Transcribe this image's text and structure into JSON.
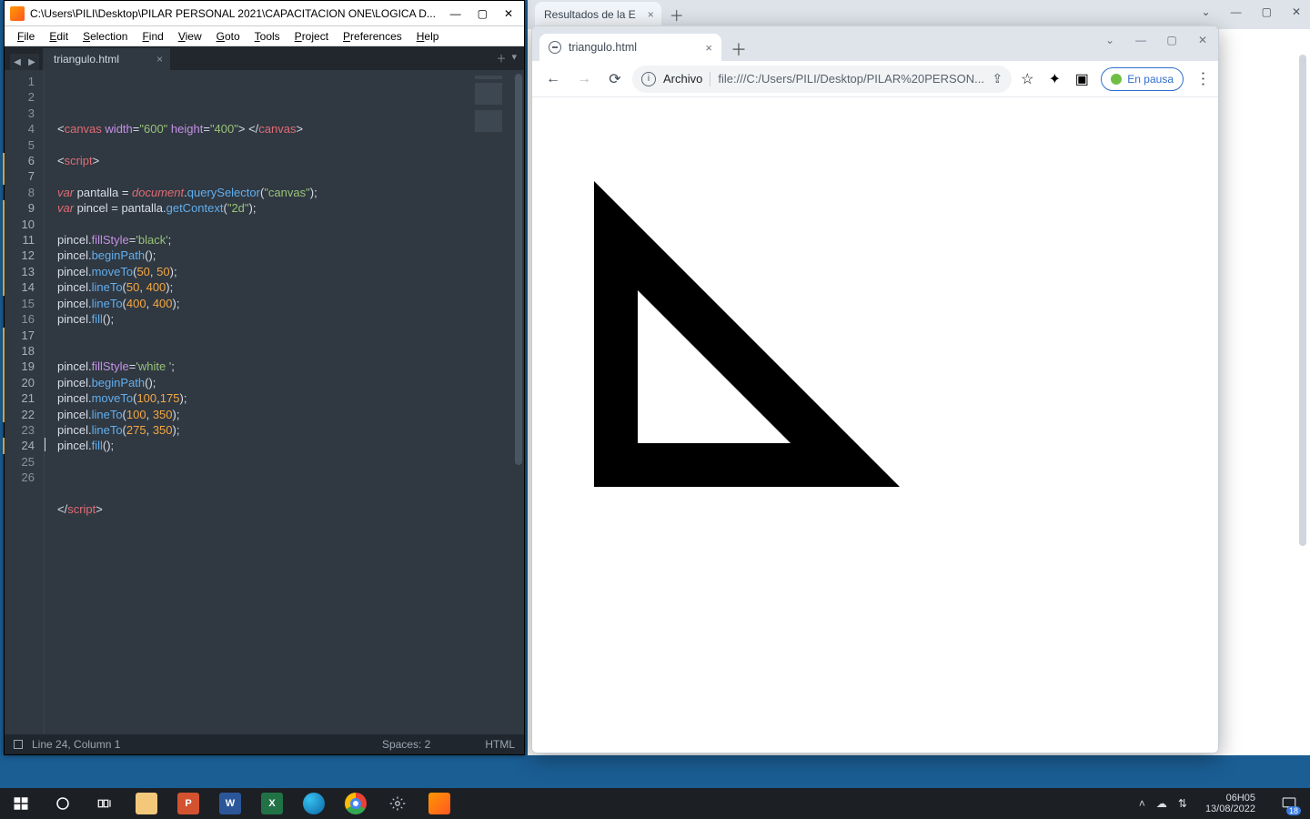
{
  "sublime": {
    "title": "C:\\Users\\PILI\\Desktop\\PILAR PERSONAL 2021\\CAPACITACION ONE\\LOGICA D...",
    "menu": [
      "File",
      "Edit",
      "Selection",
      "Find",
      "View",
      "Goto",
      "Tools",
      "Project",
      "Preferences",
      "Help"
    ],
    "tab": "triangulo.html",
    "status_left": "Line 24, Column 1",
    "status_spaces": "Spaces: 2",
    "status_lang": "HTML",
    "line_count": 26
  },
  "code_tokens": [
    [],
    [
      [
        "d",
        "<"
      ],
      [
        "t",
        "canvas"
      ],
      [
        "d",
        " "
      ],
      [
        "a",
        "width"
      ],
      [
        "d",
        "="
      ],
      [
        "s",
        "\"600\""
      ],
      [
        "d",
        " "
      ],
      [
        "a",
        "height"
      ],
      [
        "d",
        "="
      ],
      [
        "s",
        "\"400\""
      ],
      [
        "d",
        "> </"
      ],
      [
        "t",
        "canvas"
      ],
      [
        "d",
        ">"
      ]
    ],
    [],
    [
      [
        "d",
        "<"
      ],
      [
        "t",
        "script"
      ],
      [
        "d",
        ">"
      ]
    ],
    [],
    [
      [
        "k",
        "var"
      ],
      [
        "d",
        " pantalla = "
      ],
      [
        "k",
        "document"
      ],
      [
        "d",
        "."
      ],
      [
        "c",
        "querySelector"
      ],
      [
        "d",
        "("
      ],
      [
        "s",
        "\"canvas\""
      ],
      [
        "d",
        ");"
      ]
    ],
    [
      [
        "k",
        "var"
      ],
      [
        "d",
        " pincel = pantalla."
      ],
      [
        "c",
        "getContext"
      ],
      [
        "d",
        "("
      ],
      [
        "s",
        "\"2d\""
      ],
      [
        "d",
        ");"
      ]
    ],
    [],
    [
      [
        "d",
        "pincel."
      ],
      [
        "a",
        "fillStyle"
      ],
      [
        "d",
        "="
      ],
      [
        "s",
        "'black'"
      ],
      [
        "d",
        ";"
      ]
    ],
    [
      [
        "d",
        "pincel."
      ],
      [
        "c",
        "beginPath"
      ],
      [
        "d",
        "();"
      ]
    ],
    [
      [
        "d",
        "pincel."
      ],
      [
        "c",
        "moveTo"
      ],
      [
        "d",
        "("
      ],
      [
        "n",
        "50"
      ],
      [
        "d",
        ", "
      ],
      [
        "n",
        "50"
      ],
      [
        "d",
        ");"
      ]
    ],
    [
      [
        "d",
        "pincel."
      ],
      [
        "c",
        "lineTo"
      ],
      [
        "d",
        "("
      ],
      [
        "n",
        "50"
      ],
      [
        "d",
        ", "
      ],
      [
        "n",
        "400"
      ],
      [
        "d",
        ");"
      ]
    ],
    [
      [
        "d",
        "pincel."
      ],
      [
        "c",
        "lineTo"
      ],
      [
        "d",
        "("
      ],
      [
        "n",
        "400"
      ],
      [
        "d",
        ", "
      ],
      [
        "n",
        "400"
      ],
      [
        "d",
        ");"
      ]
    ],
    [
      [
        "d",
        "pincel."
      ],
      [
        "c",
        "fill"
      ],
      [
        "d",
        "();"
      ]
    ],
    [],
    [],
    [
      [
        "d",
        "pincel."
      ],
      [
        "a",
        "fillStyle"
      ],
      [
        "d",
        "="
      ],
      [
        "s",
        "'white '"
      ],
      [
        "d",
        ";"
      ]
    ],
    [
      [
        "d",
        "pincel."
      ],
      [
        "c",
        "beginPath"
      ],
      [
        "d",
        "();"
      ]
    ],
    [
      [
        "d",
        "pincel."
      ],
      [
        "c",
        "moveTo"
      ],
      [
        "d",
        "("
      ],
      [
        "n",
        "100"
      ],
      [
        "d",
        ","
      ],
      [
        "n",
        "175"
      ],
      [
        "d",
        ");"
      ]
    ],
    [
      [
        "d",
        "pincel."
      ],
      [
        "c",
        "lineTo"
      ],
      [
        "d",
        "("
      ],
      [
        "n",
        "100"
      ],
      [
        "d",
        ", "
      ],
      [
        "n",
        "350"
      ],
      [
        "d",
        ");"
      ]
    ],
    [
      [
        "d",
        "pincel."
      ],
      [
        "c",
        "lineTo"
      ],
      [
        "d",
        "("
      ],
      [
        "n",
        "275"
      ],
      [
        "d",
        ", "
      ],
      [
        "n",
        "350"
      ],
      [
        "d",
        ");"
      ]
    ],
    [
      [
        "d",
        "pincel."
      ],
      [
        "c",
        "fill"
      ],
      [
        "d",
        "();"
      ]
    ],
    [],
    [],
    [],
    [
      [
        "d",
        "</"
      ],
      [
        "t",
        "script"
      ],
      [
        "d",
        ">"
      ]
    ]
  ],
  "modified_lines": [
    6,
    7,
    9,
    10,
    11,
    12,
    13,
    14,
    17,
    18,
    19,
    20,
    21,
    22,
    24
  ],
  "bg_browser": {
    "tab_title": "Resultados de la E"
  },
  "mini": {
    "tab_title": "triangulo.html",
    "scheme_label": "Archivo",
    "url": "file:///C:/Users/PILI/Desktop/PILAR%20PERSON...",
    "pause_label": "En pausa"
  },
  "taskbar": {
    "time": "06H05",
    "date": "13/08/2022",
    "notif_count": "18"
  }
}
